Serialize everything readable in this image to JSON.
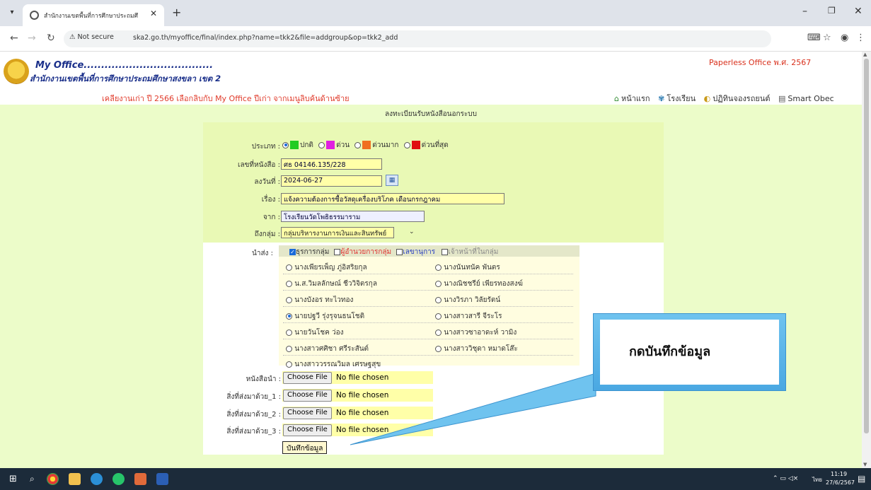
{
  "browser": {
    "tab_title": "สำนักงานเขตพื้นที่การศึกษาประถมศึ",
    "security_label": "Not secure",
    "url": "ska2.go.th/myoffice/final/index.php?name=tkk2&file=addgroup&op=tkk2_add"
  },
  "header": {
    "brand_title": "My Office.....................................",
    "brand_subtitle": "สำนักงานเขตพื้นที่การศึกษาประถมศึกษาสงขลา เขต 2",
    "paperless": "Paperless Office พ.ศ. 2567",
    "notice": "เคลียงานเก่า ปี 2566 เลือกลิบกับ My Office ปีเก่า จากเมนูลิบค้นด้านซ้าย",
    "nav": [
      "หน้าแรก",
      "โรงเรียน",
      "ปฏิทินจองรถยนต์",
      "Smart Obec"
    ]
  },
  "form": {
    "title": "ลงทะเบียนรับหนังสือนอกระบบ",
    "type_label": "ประเภท :",
    "priorities": [
      {
        "label": "ปกติ",
        "color": "#22cc22",
        "selected": true
      },
      {
        "label": "ด่วน",
        "color": "#e020e0",
        "selected": false
      },
      {
        "label": "ด่วนมาก",
        "color": "#f07020",
        "selected": false
      },
      {
        "label": "ด่วนที่สุด",
        "color": "#e01010",
        "selected": false
      }
    ],
    "doc_no_label": "เลขที่หนังสือ :",
    "doc_no": "ศธ 04146.135/228",
    "date_label": "ลงวันที่ :",
    "date": "2024-06-27",
    "subject_label": "เรื่อง :",
    "subject": "แจ้งความต้องการซื้อวัสดุเครื่องบริโภค เดือนกรกฎาคม",
    "from_label": "จาก :",
    "from": "โรงเรียนวัดโพธิธรรมาราม",
    "to_group_label": "ถึงกลุ่ม :",
    "to_group": "กลุ่มบริหารงานการเงินและสินทรัพย์",
    "send_label": "นำส่ง :",
    "send_options": [
      "ธุรการกลุ่ม",
      "ผู้อำนวยการกลุ่ม",
      "เลขานุการ",
      "เจ้าหน้าที่ในกลุ่ม"
    ],
    "people": [
      "นางเพียรเพ็ญ ภู่อิสริยกุล",
      "นางนันทนัค พันตร",
      "น.ส.วิมลลักษณ์ ชีววิจิตรกุล",
      "นางณิชชรีย์ เพียรทองสงฆ์",
      "นางบังอร ทะไวทอง",
      "นางวิรภา วิลัยรัตน์",
      "นายปฐวี รุ่งรุจนธนโชติ",
      "นางสาวสารี จีระโร",
      "นายวันโชค ว่อง",
      "นางสาวซาอาดะห์ วามิง",
      "นางสาวศศิชา ศรีระสันต์",
      "นางสาววิชุดา หมาดโส๊ะ",
      "นางสาววรรณวิมล เศรษฐสุข"
    ],
    "attach_labels": [
      "หนังสือนำ :",
      "สิ่งที่ส่งมาด้วย_1 :",
      "สิ่งที่ส่งมาด้วย_2 :",
      "สิ่งที่ส่งมาด้วย_3 :"
    ],
    "choose_file": "Choose File",
    "no_file": "No file chosen",
    "save_label": "บันทึกข้อมูล"
  },
  "callout": {
    "text": "กดบันทึกข้อมูล"
  },
  "taskbar": {
    "time": "11:19",
    "date": "27/6/2567",
    "lang": "ไทย"
  }
}
